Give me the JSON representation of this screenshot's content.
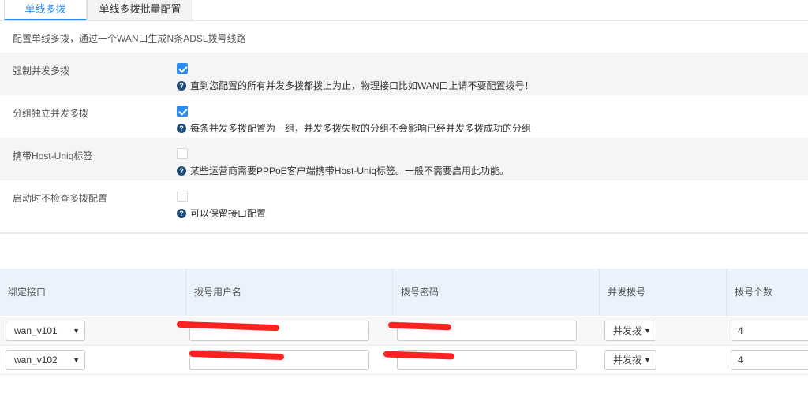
{
  "tabs": [
    "单线多拨",
    "单线多拨批量配置"
  ],
  "description": "配置单线多拨，通过一个WAN口生成N条ADSL拨号线路",
  "settings": [
    {
      "label": "强制并发多拨",
      "checked": true,
      "help": "直到您配置的所有并发多拨都拨上为止，物理接口比如WAN口上请不要配置拨号！"
    },
    {
      "label": "分组独立并发多拨",
      "checked": true,
      "help": "每条并发多拨配置为一组，并发多拨失败的分组不会影响已经并发多拨成功的分组"
    },
    {
      "label": "携带Host-Uniq标签",
      "checked": false,
      "help": "某些运营商需要PPPoE客户端携带Host-Uniq标签。一般不需要启用此功能。"
    },
    {
      "label": "启动时不检查多拨配置",
      "checked": false,
      "help": "可以保留接口配置"
    }
  ],
  "table": {
    "headers": [
      "绑定接口",
      "拨号用户名",
      "拨号密码",
      "并发拨号",
      "拨号个数"
    ],
    "rows": [
      {
        "interface": "wan_v101",
        "mode": "并发拨",
        "count": "4"
      },
      {
        "interface": "wan_v102",
        "mode": "并发拨",
        "count": "4"
      }
    ]
  },
  "colors": {
    "accent": "#2d8cf0",
    "header_bg": "#eaf3fb",
    "redaction": "#ff2020"
  },
  "icons": {
    "help": "question-circle-icon",
    "dropdown": "caret-down-icon"
  }
}
